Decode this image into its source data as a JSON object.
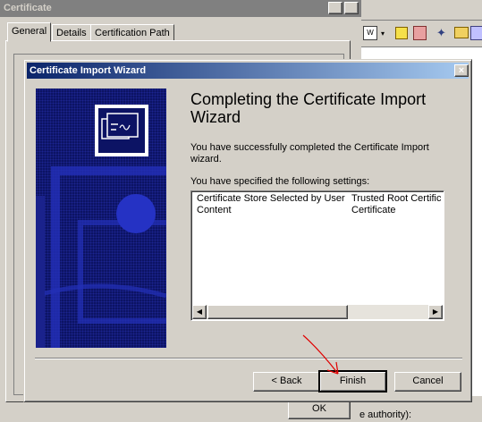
{
  "background_window": {
    "title": "Certificate",
    "help_button": "?",
    "close_button": "×",
    "tabs": [
      "General",
      "Details",
      "Certification Path"
    ],
    "ok_label": "OK"
  },
  "right_app": {
    "status_text": "e authority):"
  },
  "wizard": {
    "title": "Certificate Import Wizard",
    "close_button": "×",
    "heading": "Completing the Certificate Import Wizard",
    "description": "You have successfully completed the Certificate Import wizard.",
    "settings_label": "You have specified the following settings:",
    "settings": [
      {
        "name": "Certificate Store Selected by User",
        "value": "Trusted Root Certific"
      },
      {
        "name": "Content",
        "value": "Certificate"
      }
    ],
    "buttons": {
      "back": "< Back",
      "finish": "Finish",
      "cancel": "Cancel"
    }
  },
  "colors": {
    "titlebar_active": "#0a246a",
    "titlebar_inactive": "#808080",
    "annotation_arrow": "#e00000"
  }
}
